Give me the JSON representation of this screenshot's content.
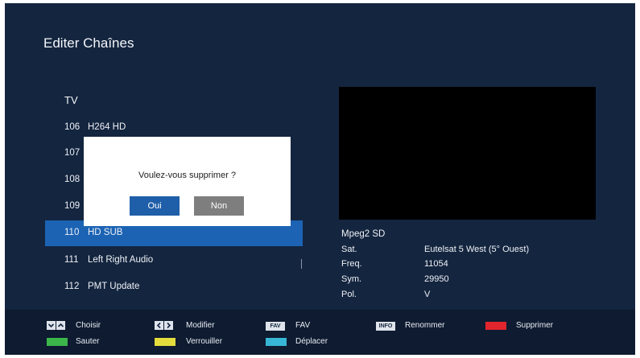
{
  "screen": {
    "title": "Editer Chaînes"
  },
  "channel_list": {
    "header": "TV",
    "rows": [
      {
        "num": "106",
        "name": "H264 HD"
      },
      {
        "num": "107",
        "name": ""
      },
      {
        "num": "108",
        "name": ""
      },
      {
        "num": "109",
        "name": ""
      },
      {
        "num": "110",
        "name": "HD SUB"
      },
      {
        "num": "111",
        "name": "Left Right Audio"
      },
      {
        "num": "112",
        "name": "PMT Update"
      }
    ],
    "selected_index": 4
  },
  "dialog": {
    "message": "Voulez-vous supprimer ?",
    "yes_label": "Oui",
    "no_label": "Non"
  },
  "info": {
    "codec": "Mpeg2 SD",
    "sat_label": "Sat.",
    "sat_value": "Eutelsat 5 West (5° Ouest)",
    "freq_label": "Freq.",
    "freq_value": "11054",
    "sym_label": "Sym.",
    "sym_value": "29950",
    "pol_label": "Pol.",
    "pol_value": "V"
  },
  "legend": {
    "choose": "Choisir",
    "modify": "Modifier",
    "fav_key": "FAV",
    "fav": "FAV",
    "info_key": "INFO",
    "rename": "Renommer",
    "delete": "Supprimer",
    "skip": "Sauter",
    "lock": "Verrouiller",
    "move": "Déplacer"
  },
  "colors": {
    "background": "#14253f",
    "selection": "#1c63b4",
    "red": "#e0262c",
    "green": "#3cb54a",
    "yellow": "#e3dc3c",
    "blue": "#38b6d6"
  },
  "icons": [
    "arrow-down-up-icon",
    "arrow-left-right-icon"
  ]
}
